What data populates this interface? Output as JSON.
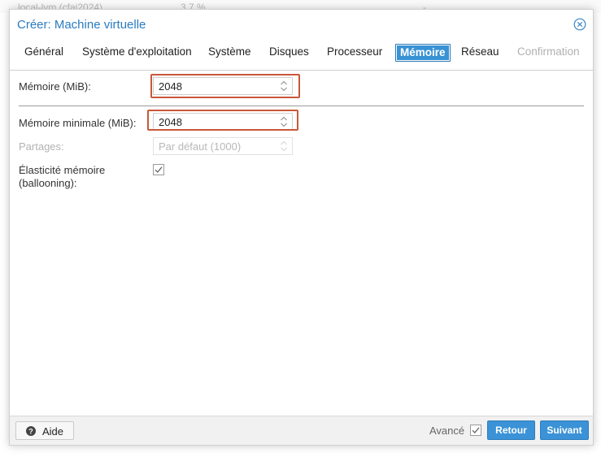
{
  "background": {
    "storage_name": "local-lvm (cfai2024)",
    "storage_usage": "3.7 %",
    "mark": "-"
  },
  "dialog": {
    "title": "Créer: Machine virtuelle",
    "close_icon": "close-circle-icon"
  },
  "tabs": [
    {
      "label": "Général",
      "state": "normal"
    },
    {
      "label": "Système d'exploitation",
      "state": "normal"
    },
    {
      "label": "Système",
      "state": "normal"
    },
    {
      "label": "Disques",
      "state": "normal"
    },
    {
      "label": "Processeur",
      "state": "normal"
    },
    {
      "label": "Mémoire",
      "state": "active"
    },
    {
      "label": "Réseau",
      "state": "normal"
    },
    {
      "label": "Confirmation",
      "state": "disabled"
    }
  ],
  "form": {
    "memory": {
      "label": "Mémoire (MiB):",
      "value": "2048"
    },
    "min_memory": {
      "label": "Mémoire minimale (MiB):",
      "value": "2048"
    },
    "shares": {
      "label": "Partages:",
      "placeholder": "Par défaut (1000)",
      "disabled": true
    },
    "ballooning": {
      "label_line1": "Élasticité mémoire",
      "label_line2": "(ballooning):",
      "checked": true
    }
  },
  "footer": {
    "help_label": "Aide",
    "help_icon": "question-circle-icon",
    "advanced_label": "Avancé",
    "advanced_checked": true,
    "back_label": "Retour",
    "next_label": "Suivant"
  },
  "colors": {
    "accent": "#3892d4",
    "title": "#2a7bc0",
    "highlight": "#c9573a"
  }
}
